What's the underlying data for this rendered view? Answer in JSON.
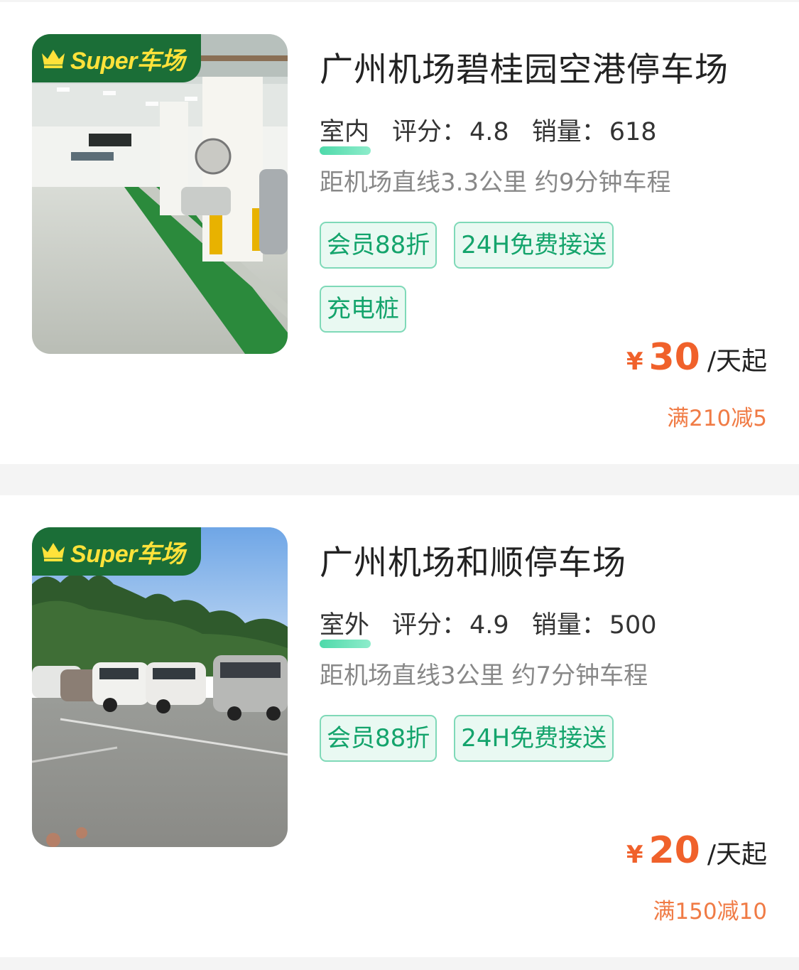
{
  "listings": [
    {
      "badge": "Super车场",
      "name": "广州机场碧桂园空港停车场",
      "environment": "室内",
      "rating_label": "评分：",
      "rating": "4.8",
      "sales_label": "销量：",
      "sales": "618",
      "distance": "距机场直线3.3公里 约9分钟车程",
      "tags": [
        "会员88折",
        "24H免费接送",
        "充电桩"
      ],
      "currency": "¥",
      "price": "30",
      "price_unit": "/天起",
      "discount": "满210减5",
      "photo": "indoor-parking-garage"
    },
    {
      "badge": "Super车场",
      "name": "广州机场和顺停车场",
      "environment": "室外",
      "rating_label": "评分：",
      "rating": "4.9",
      "sales_label": "销量：",
      "sales": "500",
      "distance": "距机场直线3公里 约7分钟车程",
      "tags": [
        "会员88折",
        "24H免费接送"
      ],
      "currency": "¥",
      "price": "20",
      "price_unit": "/天起",
      "discount": "满150减10",
      "photo": "outdoor-gravel-parking-lot"
    }
  ],
  "colors": {
    "accent_green": "#14a46c",
    "price_orange": "#f0612b",
    "badge_green": "#1b6e37",
    "badge_text": "#ffe23a"
  },
  "icons": [
    "crown-icon"
  ]
}
